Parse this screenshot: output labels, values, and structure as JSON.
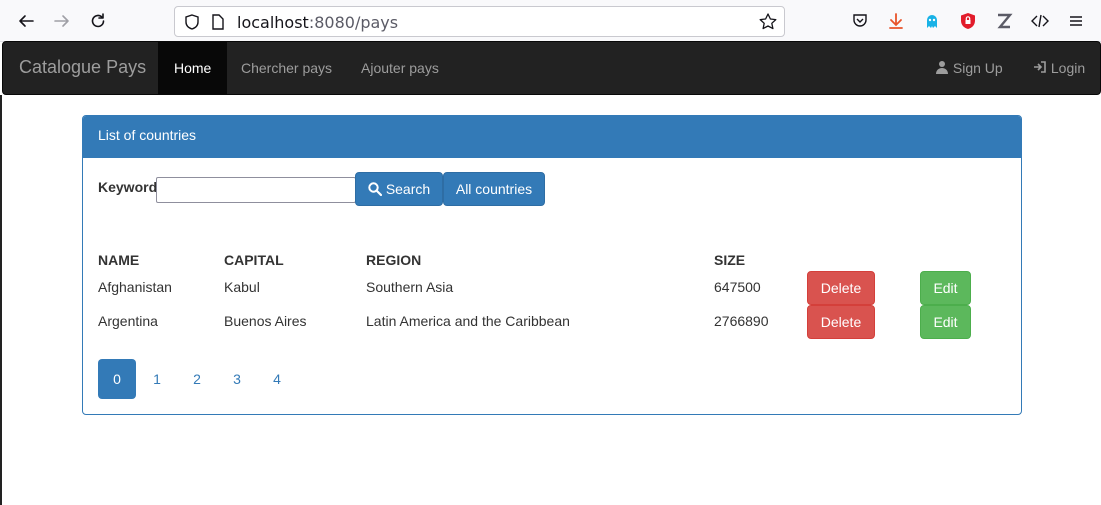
{
  "browser": {
    "url_host": "localhost",
    "url_rest": ":8080/pays"
  },
  "navbar": {
    "brand": "Catalogue Pays",
    "items": [
      {
        "label": "Home",
        "active": true
      },
      {
        "label": "Chercher pays",
        "active": false
      },
      {
        "label": "Ajouter pays",
        "active": false
      }
    ],
    "signup": "Sign Up",
    "login": "Login"
  },
  "panel": {
    "heading": "List of countries",
    "keyword_label": "Keyword",
    "keyword_value": "",
    "search_label": "Search",
    "all_label": "All countries"
  },
  "table": {
    "headers": [
      "NAME",
      "CAPITAL",
      "REGION",
      "SIZE"
    ],
    "rows": [
      {
        "name": "Afghanistan",
        "capital": "Kabul",
        "region": "Southern Asia",
        "size": "647500",
        "delete": "Delete",
        "edit": "Edit"
      },
      {
        "name": "Argentina",
        "capital": "Buenos Aires",
        "region": "Latin America and the Caribbean",
        "size": "2766890",
        "delete": "Delete",
        "edit": "Edit"
      }
    ]
  },
  "pagination": {
    "pages": [
      "0",
      "1",
      "2",
      "3",
      "4"
    ],
    "active": "0"
  },
  "colors": {
    "primary": "#337ab7",
    "danger": "#d9534f",
    "success": "#5cb85c",
    "navbar": "#222222"
  }
}
